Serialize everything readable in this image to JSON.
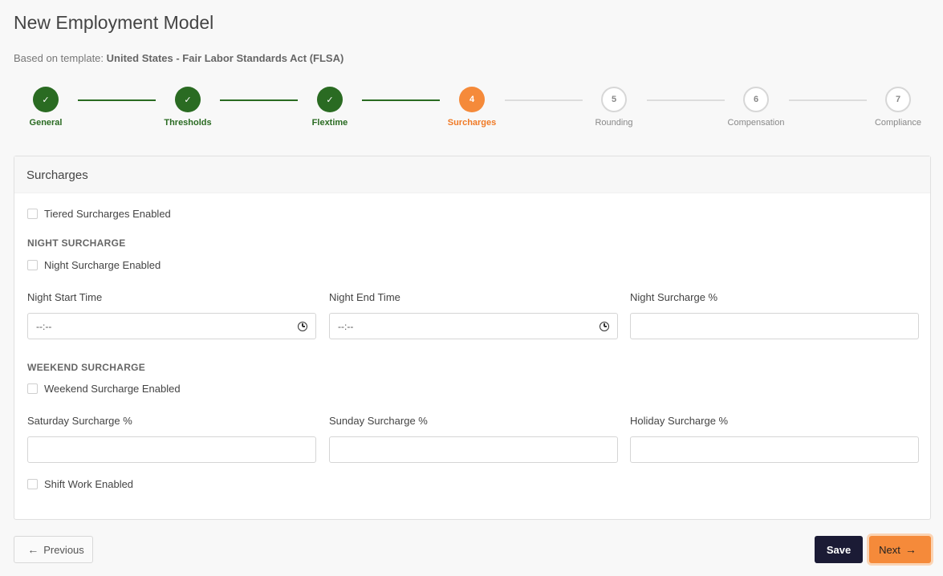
{
  "page": {
    "title": "New Employment Model",
    "template_prefix": "Based on template:",
    "template_name": "United States - Fair Labor Standards Act (FLSA)"
  },
  "steps": [
    {
      "label": "General",
      "number": "1",
      "status": "done"
    },
    {
      "label": "Thresholds",
      "number": "2",
      "status": "done"
    },
    {
      "label": "Flextime",
      "number": "3",
      "status": "done"
    },
    {
      "label": "Surcharges",
      "number": "4",
      "status": "active"
    },
    {
      "label": "Rounding",
      "number": "5",
      "status": "todo"
    },
    {
      "label": "Compensation",
      "number": "6",
      "status": "todo"
    },
    {
      "label": "Compliance",
      "number": "7",
      "status": "todo"
    }
  ],
  "card": {
    "title": "Surcharges",
    "tiered_label": "Tiered Surcharges Enabled",
    "night_section": "NIGHT SURCHARGE",
    "night_enabled_label": "Night Surcharge Enabled",
    "night_start_label": "Night Start Time",
    "night_start_value": "--:--",
    "night_end_label": "Night End Time",
    "night_end_value": "--:--",
    "night_pct_label": "Night Surcharge %",
    "weekend_section": "WEEKEND SURCHARGE",
    "weekend_enabled_label": "Weekend Surcharge Enabled",
    "saturday_label": "Saturday Surcharge %",
    "sunday_label": "Sunday Surcharge %",
    "holiday_label": "Holiday Surcharge %",
    "shift_label": "Shift Work Enabled"
  },
  "footer": {
    "previous": "Previous",
    "save": "Save",
    "next": "Next"
  },
  "colors": {
    "done": "#2a6b22",
    "active": "#f58a3a",
    "save_button": "#1b1b35"
  }
}
